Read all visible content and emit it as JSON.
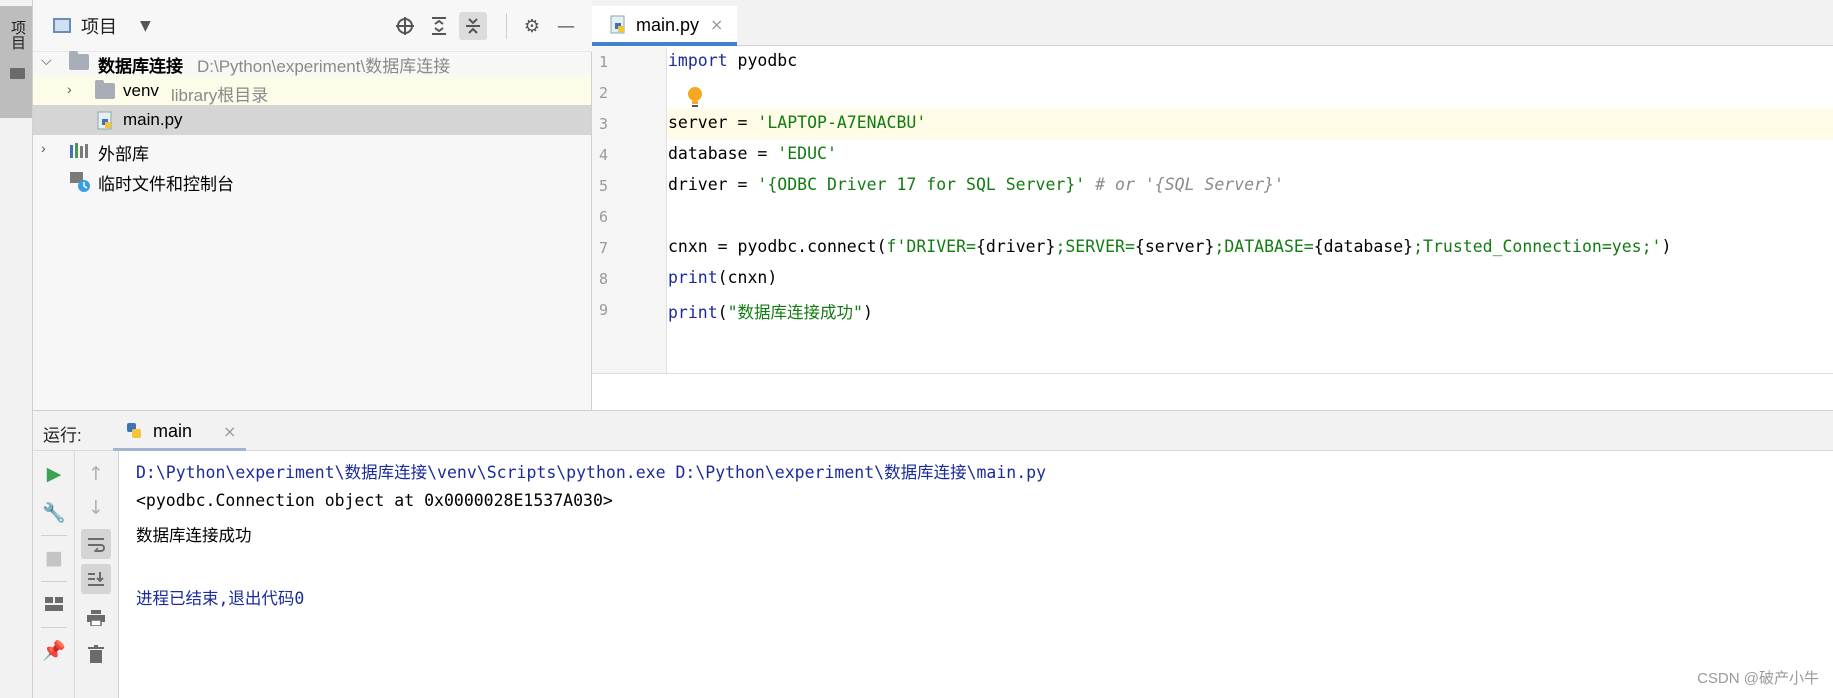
{
  "tool_strip": {
    "project_tab_label": "项目"
  },
  "project_panel": {
    "header": {
      "title": "项目"
    },
    "tree": [
      {
        "label": "数据库连接",
        "hint": "D:\\Python\\experiment\\数据库连接"
      },
      {
        "label": "venv",
        "hint": "library根目录"
      },
      {
        "label": "main.py",
        "hint": ""
      },
      {
        "label": "外部库",
        "hint": ""
      },
      {
        "label": "临时文件和控制台",
        "hint": ""
      }
    ]
  },
  "editor": {
    "tab": {
      "label": "main.py",
      "close": "×"
    },
    "line_numbers": [
      "1",
      "2",
      "3",
      "4",
      "5",
      "6",
      "7",
      "8",
      "9"
    ],
    "code": {
      "l1_kw": "import",
      "l1_rest": " pyodbc",
      "l3_a": "server = ",
      "l3_str": "'LAPTOP-A7ENACBU'",
      "l4_a": "database = ",
      "l4_str": "'EDUC'",
      "l5_a": "driver = ",
      "l5_str": "'{ODBC Driver 17 for SQL Server}'",
      "l5_cmt": " # or '{SQL Server}'",
      "l7_a": "cnxn = pyodbc.connect(",
      "l7_s1": "f'DRIVER=",
      "l7_v1": "{driver}",
      "l7_s2": ";SERVER=",
      "l7_v2": "{server}",
      "l7_s3": ";DATABASE=",
      "l7_v3": "{database}",
      "l7_s4": ";Trusted_Connection=yes;'",
      "l7_end": ")",
      "l8_fn": "print",
      "l8_rest": "(cnxn)",
      "l9_fn": "print",
      "l9_open": "(",
      "l9_str": "\"数据库连接成功\"",
      "l9_close": ")"
    }
  },
  "run_panel": {
    "title": "运行:",
    "tab": {
      "label": "main",
      "close": "×"
    },
    "console": [
      "D:\\Python\\experiment\\数据库连接\\venv\\Scripts\\python.exe D:\\Python\\experiment\\数据库连接\\main.py",
      "<pyodbc.Connection object at 0x0000028E1537A030>",
      "数据库连接成功",
      "进程已结束,退出代码0"
    ]
  },
  "watermark": "CSDN @破产小牛",
  "colors": {
    "accent": "#4083c9",
    "keyword": "#1a2b9b",
    "string": "#127c12",
    "run_green": "#3aa34f"
  }
}
